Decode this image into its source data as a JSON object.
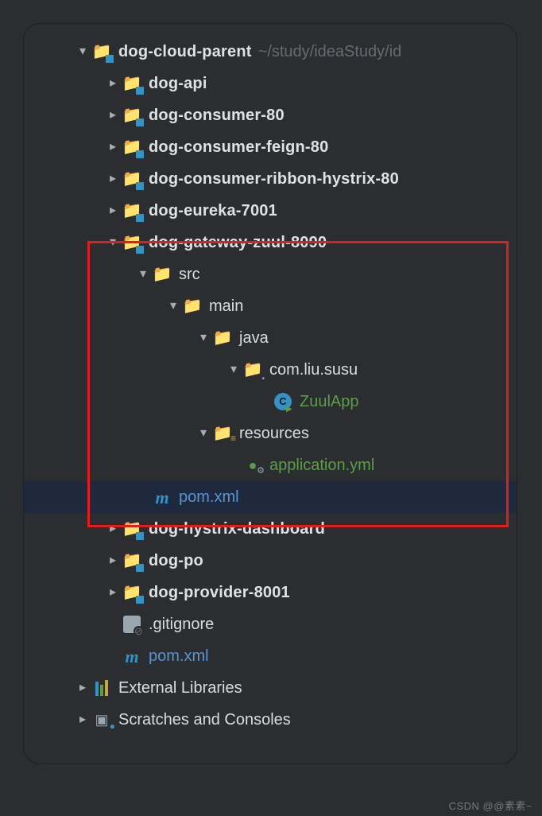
{
  "root": {
    "label": "dog-cloud-parent",
    "path": "~/study/ideaStudy/id"
  },
  "modules": [
    {
      "label": "dog-api"
    },
    {
      "label": "dog-consumer-80"
    },
    {
      "label": "dog-consumer-feign-80"
    },
    {
      "label": "dog-consumer-ribbon-hystrix-80"
    },
    {
      "label": "dog-eureka-7001"
    }
  ],
  "expanded": {
    "label": "dog-gateway-zuul-8090",
    "src": "src",
    "main": "main",
    "java": "java",
    "pkg": "com.liu.susu",
    "class": "ZuulApp",
    "resources": "resources",
    "yml": "application.yml",
    "pom": "pom.xml"
  },
  "modules2": [
    {
      "label": "dog-hystrix-dashboard"
    },
    {
      "label": "dog-po"
    },
    {
      "label": "dog-provider-8001"
    }
  ],
  "gitignore": ".gitignore",
  "rootPom": "pom.xml",
  "external": "External Libraries",
  "scratches": "Scratches and Consoles",
  "watermark": "CSDN @@素素~"
}
